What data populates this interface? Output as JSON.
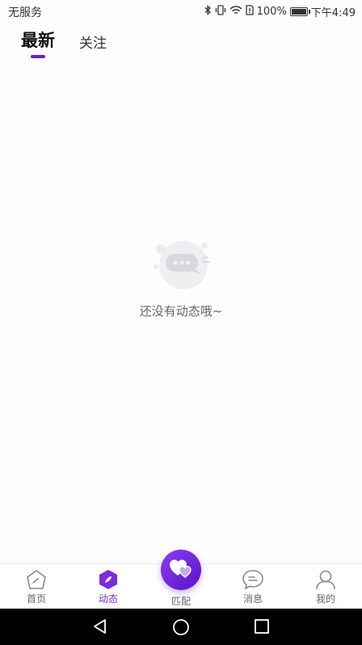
{
  "status_bar": {
    "carrier": "无服务",
    "battery": "100%",
    "battery_level": 1.0,
    "time": "下午4:49",
    "icons": [
      "bluetooth-icon",
      "vibrate-icon",
      "wifi-icon",
      "sim-icon",
      "battery-icon"
    ]
  },
  "tabs": [
    {
      "label": "最新",
      "active": true
    },
    {
      "label": "关注",
      "active": false
    }
  ],
  "empty_state": {
    "text": "还没有动态哦~",
    "icon": "chat-bubble-icon"
  },
  "bottom_nav": {
    "items": [
      {
        "label": "首页",
        "icon": "home-icon",
        "active": false
      },
      {
        "label": "动态",
        "icon": "feed-icon",
        "active": true
      },
      {
        "label": "匹配",
        "icon": "heart-match-icon",
        "active": false
      },
      {
        "label": "消息",
        "icon": "message-icon",
        "active": false
      },
      {
        "label": "我的",
        "icon": "profile-icon",
        "active": false
      }
    ]
  },
  "colors": {
    "accent": "#6a1fd6",
    "accent_light": "#8b3cf0",
    "text_primary": "#111111",
    "text_secondary": "#666666"
  },
  "system_nav": [
    "back-icon",
    "home-circle-icon",
    "recents-icon"
  ]
}
